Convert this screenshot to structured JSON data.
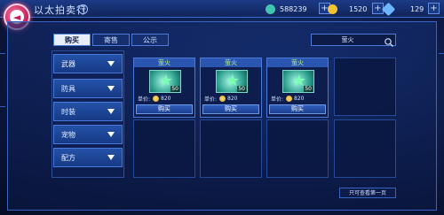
{
  "header": {
    "title": "以太拍卖行",
    "help_label": "?",
    "currencies": [
      {
        "icon": "gem-icon",
        "value": "588239",
        "color": "#3fc6b0"
      },
      {
        "icon": "gold-coin-icon",
        "value": "1520",
        "color": "#f2c230"
      },
      {
        "icon": "ticket-icon",
        "value": "129",
        "color": "#6fb4ff"
      }
    ],
    "plus_label": "+"
  },
  "tabs": [
    {
      "label": "购买",
      "active": true
    },
    {
      "label": "寄售",
      "active": false
    },
    {
      "label": "公示",
      "active": false
    }
  ],
  "search": {
    "value": "萤火"
  },
  "categories": [
    "武器",
    "防具",
    "时装",
    "宠物",
    "配方"
  ],
  "items": [
    {
      "name": "萤火",
      "count": "50",
      "price_label": "单价:",
      "price": "820",
      "buy_label": "购买"
    },
    {
      "name": "萤火",
      "count": "50",
      "price_label": "单价:",
      "price": "820",
      "buy_label": "购买"
    },
    {
      "name": "萤火",
      "count": "50",
      "price_label": "单价:",
      "price": "820",
      "buy_label": "购买"
    }
  ],
  "footer": {
    "page_note": "只可查看第一页"
  }
}
